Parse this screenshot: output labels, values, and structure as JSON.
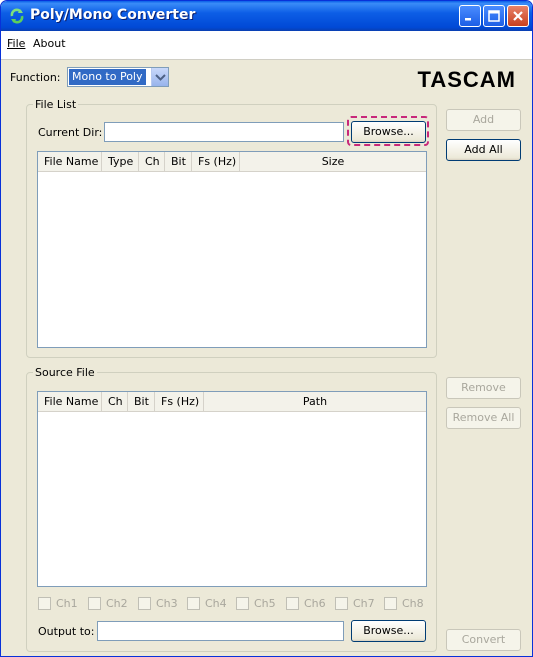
{
  "window": {
    "title": "Poly/Mono Converter"
  },
  "menu": {
    "file": "File",
    "about": "About"
  },
  "function": {
    "label": "Function:",
    "selected": "Mono to Poly"
  },
  "brand": "TASCAM",
  "file_list": {
    "title": "File List",
    "current_dir_label": "Current Dir:",
    "current_dir_value": "",
    "browse_label": "Browse...",
    "columns": [
      "File Name",
      "Type",
      "Ch",
      "Bit",
      "Fs (Hz)",
      "Size"
    ]
  },
  "side_buttons": {
    "add": "Add",
    "add_all": "Add All",
    "remove": "Remove",
    "remove_all": "Remove All",
    "convert": "Convert"
  },
  "source_file": {
    "title": "Source File",
    "columns": [
      "File Name",
      "Ch",
      "Bit",
      "Fs (Hz)",
      "Path"
    ],
    "channels": [
      "Ch1",
      "Ch2",
      "Ch3",
      "Ch4",
      "Ch5",
      "Ch6",
      "Ch7",
      "Ch8"
    ],
    "output_label": "Output to:",
    "output_value": "",
    "browse_label": "Browse..."
  }
}
